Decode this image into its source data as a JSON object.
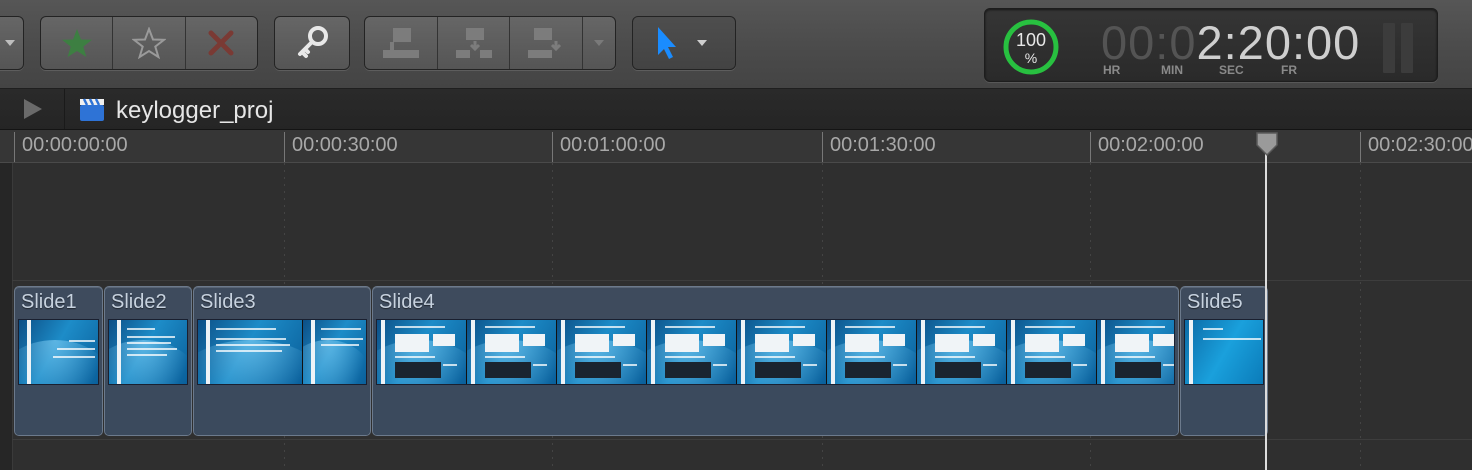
{
  "toolbar": {
    "rate_group": [
      {
        "icon": "favorite-star-icon",
        "color": "#3d7f42"
      },
      {
        "icon": "unrate-star-icon",
        "color": "#9a9a9a"
      },
      {
        "icon": "reject-x-icon",
        "color": "#7a3a34"
      }
    ],
    "keyword_icon": "key-icon",
    "edit_group": [
      "connect-clip-icon",
      "insert-clip-icon",
      "append-clip-icon",
      "chevron-down-icon"
    ],
    "tool_select": {
      "icon": "arrow-cursor-icon",
      "color": "#1a8cff"
    }
  },
  "timecode": {
    "percent": "100",
    "percent_sign": "%",
    "dim_digits": "00:0",
    "lit_digits": "2:20:00",
    "units": [
      "HR",
      "MIN",
      "SEC",
      "FR"
    ],
    "ring_color": "#28c040"
  },
  "project": {
    "name": "keylogger_proj",
    "icon": "clapperboard-icon"
  },
  "ruler": {
    "labels": [
      "00:00:00:00",
      "00:00:30:00",
      "00:01:00:00",
      "00:01:30:00",
      "00:02:00:00",
      "00:02:30:00"
    ]
  },
  "clips": [
    {
      "title": "Slide1",
      "thumbs": 1
    },
    {
      "title": "Slide2",
      "thumbs": 1
    },
    {
      "title": "Slide3",
      "thumbs": 2
    },
    {
      "title": "Slide4",
      "thumbs": 9
    },
    {
      "title": "Slide5",
      "thumbs": 1
    }
  ],
  "playhead": {
    "timecode_seconds": 140
  }
}
